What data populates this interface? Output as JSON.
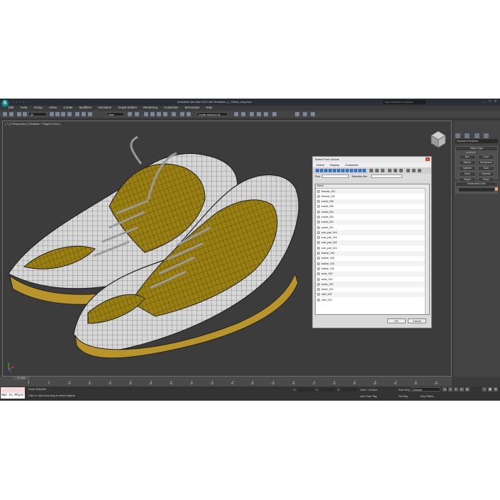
{
  "titlebar": {
    "title": "Autodesk 3ds Max 2012 x64    Sneakers_1_Yellow_vray.max",
    "search_placeholder": "Type a keyword or phrase",
    "logo_letter": "S",
    "quick_access": "▫ ▫ ▫ ▫ ▫ ▫"
  },
  "menubar": [
    "Edit",
    "Tools",
    "Group",
    "Views",
    "Create",
    "Modifiers",
    "Animation",
    "Graph Editors",
    "Rendering",
    "Customize",
    "MAXScript",
    "Help"
  ],
  "toolbar": {
    "filter": "All",
    "view": "View",
    "selection_set": "Create Selection Se"
  },
  "viewport": {
    "label": "[ + ] [ Perspective ] [ Realistic + Edged Faces ]"
  },
  "dialog": {
    "title": "Select From Scene",
    "close": "x",
    "menu": [
      "Select",
      "Display",
      "Customize"
    ],
    "find_label": "Find:",
    "selection_set_label": "Selection Set:",
    "column_name": "Name",
    "items": [
      "threads_002",
      "threads_001",
      "suede_006",
      "suede_005",
      "suede_004",
      "suede_003",
      "suede_002",
      "suede_001",
      "sole_part_004",
      "sole_part_003",
      "sole_part_002",
      "sole_part_001",
      "leather_004",
      "leather_003",
      "leather_002",
      "leather_001",
      "laces_002",
      "laces_001",
      "insole_002",
      "insole_001",
      "cloth_002",
      "cloth_001"
    ],
    "ok": "OK",
    "cancel": "Cancel"
  },
  "command_panel": {
    "dropdown": "Standard Primitives",
    "object_type_header": "Object Type",
    "autogrid": "AutoGrid",
    "buttons": [
      "Box",
      "Cone",
      "Sphere",
      "GeoSphere",
      "Cylinder",
      "Tube",
      "Torus",
      "Pyramid",
      "Teapot",
      "Plane"
    ],
    "name_color_header": "Name and Color"
  },
  "timeline": {
    "frame_label": "0 / 100",
    "ticks": [
      "0",
      "5",
      "10",
      "15",
      "20",
      "25",
      "30",
      "35",
      "40",
      "45",
      "50",
      "55",
      "60",
      "65",
      "70",
      "75",
      "80",
      "85",
      "90",
      "95",
      "100"
    ]
  },
  "statusbar": {
    "maxscript_label": "Max to Physc",
    "status": "None Selected",
    "prompt": "Click or click-and-drag to select objects",
    "x_label": "X:",
    "y_label": "Y:",
    "z_label": "Z:",
    "grid": "Grid = 10,0cm",
    "add_time_tag": "Add Time Tag",
    "auto_key": "Auto Key",
    "set_key": "Set Key",
    "selected": "Selected",
    "key_filters": "Key Filters..."
  },
  "colors": {
    "sneaker_yellow": "#9a7f12",
    "mesh_white": "#d9d9d9",
    "viewport_bg": "#3c3c3c",
    "accent": "#3b73c8"
  }
}
